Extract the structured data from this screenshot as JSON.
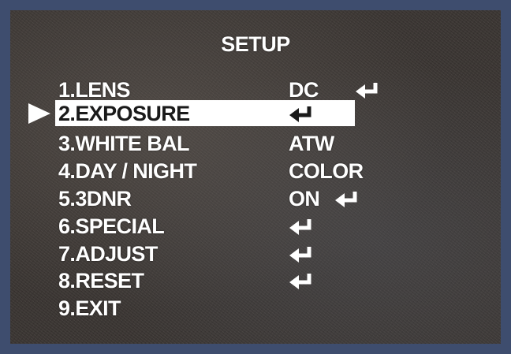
{
  "menu": {
    "title": "SETUP",
    "items": [
      {
        "label": "1.LENS",
        "value": "DC",
        "enter": true
      },
      {
        "label": "2.EXPOSURE",
        "value": "",
        "enter": true,
        "selected": true
      },
      {
        "label": "3.WHITE BAL",
        "value": "ATW",
        "enter": false
      },
      {
        "label": "4.DAY / NIGHT",
        "value": "COLOR",
        "enter": false
      },
      {
        "label": "5.3DNR",
        "value": "ON",
        "enter": true
      },
      {
        "label": "6.SPECIAL",
        "value": "",
        "enter": true
      },
      {
        "label": "7.ADJUST",
        "value": "",
        "enter": true
      },
      {
        "label": "8.RESET",
        "value": "",
        "enter": true
      },
      {
        "label": "9.EXIT",
        "value": "",
        "enter": false
      }
    ]
  },
  "colors": {
    "frame": "#3e4d6e",
    "text": "#ffffff",
    "highlight": "#ffffff",
    "highlight_text": "#1a1a1a"
  },
  "icons": {
    "cursor": "triangle-right-icon",
    "enter": "enter-arrow-icon"
  }
}
